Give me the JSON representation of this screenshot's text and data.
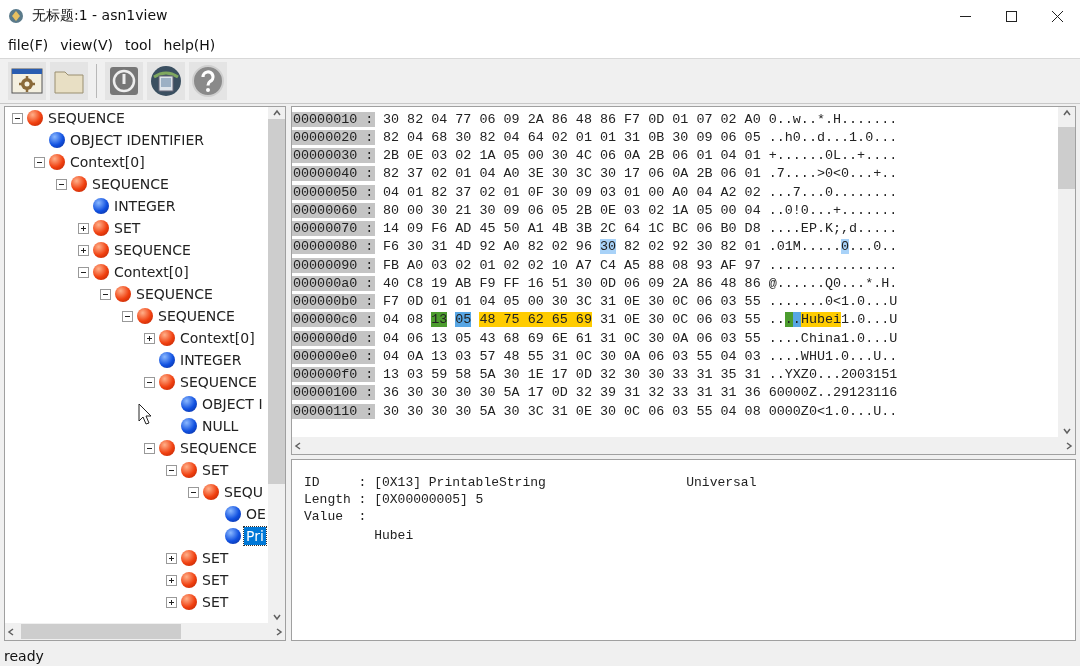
{
  "window": {
    "title": "无标题:1 - asn1view"
  },
  "menu": [
    {
      "label": "file(F)"
    },
    {
      "label": "view(V)"
    },
    {
      "label": "tool"
    },
    {
      "label": "help(H)"
    }
  ],
  "toolbar": [
    {
      "kind": "gear-window"
    },
    {
      "kind": "folder"
    },
    {
      "kind": "info"
    },
    {
      "kind": "globe-picture"
    },
    {
      "kind": "help"
    }
  ],
  "tree": {
    "items": [
      {
        "label": "SEQUENCE",
        "kind": "constructed",
        "expanded": true,
        "selected": false,
        "children": [
          {
            "label": "OBJECT IDENTIFIER",
            "kind": "primitive",
            "selected": false
          },
          {
            "label": "Context[0]",
            "kind": "constructed",
            "expanded": true,
            "selected": false,
            "children": [
              {
                "label": "SEQUENCE",
                "kind": "constructed",
                "expanded": true,
                "selected": false,
                "children": [
                  {
                    "label": "INTEGER",
                    "kind": "primitive",
                    "selected": false
                  },
                  {
                    "label": "SET",
                    "kind": "constructed",
                    "expanded": false,
                    "selected": false
                  },
                  {
                    "label": "SEQUENCE",
                    "kind": "constructed",
                    "expanded": false,
                    "selected": false
                  },
                  {
                    "label": "Context[0]",
                    "kind": "constructed",
                    "expanded": true,
                    "selected": false,
                    "children": [
                      {
                        "label": "SEQUENCE",
                        "kind": "constructed",
                        "expanded": true,
                        "selected": false,
                        "children": [
                          {
                            "label": "SEQUENCE",
                            "kind": "constructed",
                            "expanded": true,
                            "selected": false,
                            "children": [
                              {
                                "label": "Context[0]",
                                "kind": "constructed",
                                "expanded": false,
                                "selected": false
                              },
                              {
                                "label": "INTEGER",
                                "kind": "primitive",
                                "selected": false
                              },
                              {
                                "label": "SEQUENCE",
                                "kind": "constructed",
                                "expanded": true,
                                "selected": false,
                                "children": [
                                  {
                                    "label": "OBJECT I",
                                    "kind": "primitive",
                                    "selected": false
                                  },
                                  {
                                    "label": "NULL",
                                    "kind": "primitive",
                                    "selected": false
                                  }
                                ]
                              },
                              {
                                "label": "SEQUENCE",
                                "kind": "constructed",
                                "expanded": true,
                                "selected": false,
                                "children": [
                                  {
                                    "label": "SET",
                                    "kind": "constructed",
                                    "expanded": true,
                                    "selected": false,
                                    "children": [
                                      {
                                        "label": "SEQU",
                                        "kind": "constructed",
                                        "expanded": true,
                                        "selected": false,
                                        "children": [
                                          {
                                            "label": "OE",
                                            "kind": "primitive",
                                            "selected": false
                                          },
                                          {
                                            "label": "Pri",
                                            "kind": "primitive",
                                            "selected": true
                                          }
                                        ]
                                      }
                                    ]
                                  },
                                  {
                                    "label": "SET",
                                    "kind": "constructed",
                                    "expanded": false,
                                    "selected": false
                                  },
                                  {
                                    "label": "SET",
                                    "kind": "constructed",
                                    "expanded": false,
                                    "selected": false
                                  },
                                  {
                                    "label": "SET",
                                    "kind": "constructed",
                                    "expanded": false,
                                    "selected": false
                                  }
                                ]
                              }
                            ]
                          }
                        ]
                      }
                    ]
                  }
                ]
              }
            ]
          }
        ]
      }
    ]
  },
  "hex": {
    "rows": [
      {
        "offset": "00000010 :",
        "hex": [
          {
            "text": "30 82 04 77 06 09 2A 86 48 86 F7 0D 01 07 02 A0"
          }
        ],
        "ascii": [
          {
            "text": "0..w..*.H......."
          }
        ]
      },
      {
        "offset": "00000020 :",
        "hex": [
          {
            "text": "82 04 68 30 82 04 64 02 01 01 31 0B 30 09 06 05"
          }
        ],
        "ascii": [
          {
            "text": "..h0..d...1.0..."
          }
        ]
      },
      {
        "offset": "00000030 :",
        "hex": [
          {
            "text": "2B 0E 03 02 1A 05 00 30 4C 06 0A 2B 06 01 04 01"
          }
        ],
        "ascii": [
          {
            "text": "+......0L..+...."
          }
        ]
      },
      {
        "offset": "00000040 :",
        "hex": [
          {
            "text": "82 37 02 01 04 A0 3E 30 3C 30 17 06 0A 2B 06 01"
          }
        ],
        "ascii": [
          {
            "text": ".7....>0<0...+.."
          }
        ]
      },
      {
        "offset": "00000050 :",
        "hex": [
          {
            "text": "04 01 82 37 02 01 0F 30 09 03 01 00 A0 04 A2 02"
          }
        ],
        "ascii": [
          {
            "text": "...7...0........"
          }
        ]
      },
      {
        "offset": "00000060 :",
        "hex": [
          {
            "text": "80 00 30 21 30 09 06 05 2B 0E 03 02 1A 05 00 04"
          }
        ],
        "ascii": [
          {
            "text": "..0!0...+......."
          }
        ]
      },
      {
        "offset": "00000070 :",
        "hex": [
          {
            "text": "14 09 F6 AD 45 50 A1 4B 3B 2C 64 1C BC 06 B0 D8"
          }
        ],
        "ascii": [
          {
            "text": "....EP.K;,d....."
          }
        ]
      },
      {
        "offset": "00000080 :",
        "hex": [
          {
            "text": "F6 30 31 4D 92 A0 82 02 96"
          },
          {
            "text": "30",
            "color": "#a8d2f8"
          },
          {
            "text": "82 02 92 30 82 01"
          }
        ],
        "ascii": [
          {
            "text": ".01M....."
          },
          {
            "text": "0",
            "color": "#a8d2f8"
          },
          {
            "text": "...0.."
          }
        ]
      },
      {
        "offset": "00000090 :",
        "hex": [
          {
            "text": "FB A0 03 02 01 02 02 10 A7 C4 A5 88 08 93 AF 97"
          }
        ],
        "ascii": [
          {
            "text": "................"
          }
        ]
      },
      {
        "offset": "000000a0 :",
        "hex": [
          {
            "text": "40 C8 19 AB F9 FF 16 51 30 0D 06 09 2A 86 48 86"
          }
        ],
        "ascii": [
          {
            "text": "@......Q0...*.H."
          }
        ]
      },
      {
        "offset": "000000b0 :",
        "hex": [
          {
            "text": "F7 0D 01 01 04 05 00 30 3C 31 0E 30 0C 06 03 55"
          }
        ],
        "ascii": [
          {
            "text": ".......0<1.0...U"
          }
        ]
      },
      {
        "offset": "000000c0 :",
        "hex": [
          {
            "text": "04 08"
          },
          {
            "text": "13",
            "color": "#4c9c2e"
          },
          {
            "text": "05",
            "color": "#58a6e4"
          },
          {
            "text": "48 75 62 65 69",
            "color": "#ffcc00"
          },
          {
            "text": "31 0E 30 0C 06 03 55"
          }
        ],
        "ascii": [
          {
            "text": ".."
          },
          {
            "text": ".",
            "color": "#4c9c2e"
          },
          {
            "text": ".",
            "color": "#58a6e4"
          },
          {
            "text": "Hubei",
            "color": "#ffcc00"
          },
          {
            "text": "1.0...U"
          }
        ]
      },
      {
        "offset": "000000d0 :",
        "hex": [
          {
            "text": "04 06 13 05 43 68 69 6E 61 31 0C 30 0A 06 03 55"
          }
        ],
        "ascii": [
          {
            "text": "....China1.0...U"
          }
        ]
      },
      {
        "offset": "000000e0 :",
        "hex": [
          {
            "text": "04 0A 13 03 57 48 55 31 0C 30 0A 06 03 55 04 03"
          }
        ],
        "ascii": [
          {
            "text": "....WHU1.0...U.."
          }
        ]
      },
      {
        "offset": "000000f0 :",
        "hex": [
          {
            "text": "13 03 59 58 5A 30 1E 17 0D 32 30 30 33 31 35 31"
          }
        ],
        "ascii": [
          {
            "text": "..YXZ0...2003151"
          }
        ]
      },
      {
        "offset": "00000100 :",
        "hex": [
          {
            "text": "36 30 30 30 30 5A 17 0D 32 39 31 32 33 31 31 36"
          }
        ],
        "ascii": [
          {
            "text": "60000Z..29123116"
          }
        ]
      },
      {
        "offset": "00000110 :",
        "hex": [
          {
            "text": "30 30 30 30 5A 30 3C 31 0E 30 0C 06 03 55 04 08"
          }
        ],
        "ascii": [
          {
            "text": "0000Z0<1.0...U.."
          }
        ]
      }
    ]
  },
  "detail": {
    "fields": [
      {
        "label": "ID",
        "colon": ":",
        "value": "[0X13] PrintableString",
        "extra": "Universal",
        "kind": "inline"
      },
      {
        "label": "Length",
        "colon": ":",
        "value": "[0X00000005] 5",
        "kind": "inline"
      },
      {
        "label": "Value",
        "colon": ":",
        "value": "Hubei",
        "kind": "block"
      }
    ]
  },
  "status_bar": {
    "text": "ready"
  }
}
